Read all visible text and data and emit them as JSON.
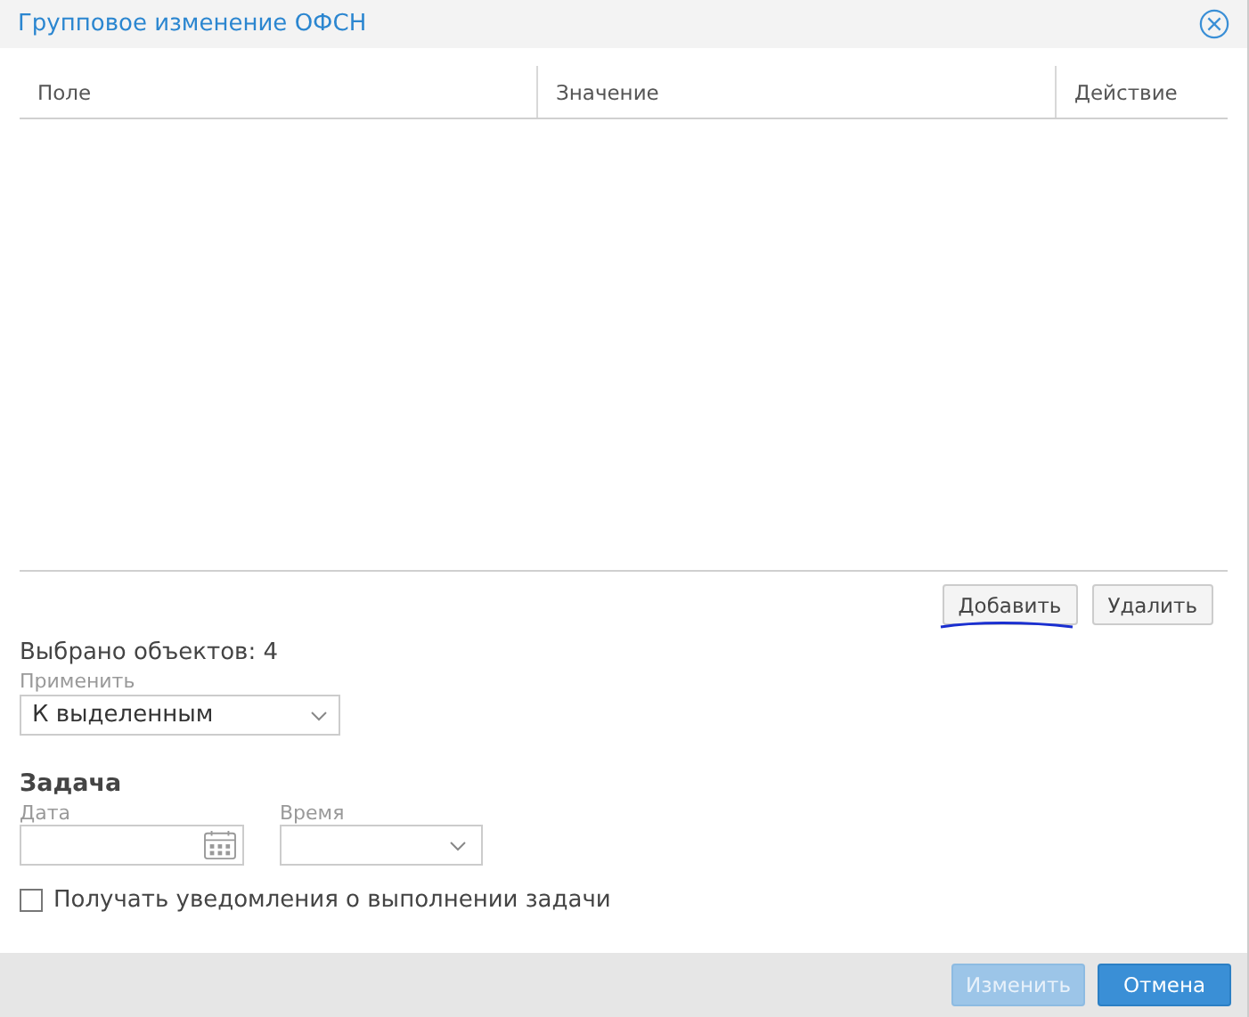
{
  "window": {
    "title": "Групповое изменение ОФСН"
  },
  "table": {
    "columns": [
      "Поле",
      "Значение",
      "Действие"
    ]
  },
  "table_buttons": [
    {
      "label": "Добавить",
      "underlined": true
    },
    {
      "label": "Удалить",
      "underlined": false
    }
  ],
  "selected_count": "Выбрано объектов: 4",
  "apply": {
    "label": "Применить",
    "value": "К выделенным"
  },
  "task": {
    "heading": "Задача",
    "date_label": "Дата",
    "time_label": "Время"
  },
  "notify": {
    "label": "Получать уведомления о выполнении задачи",
    "checked": false
  },
  "footer_buttons": [
    {
      "label": "Изменить",
      "kind": "primary",
      "disabled": true
    },
    {
      "label": "Отмена",
      "kind": "primary",
      "disabled": false
    }
  ]
}
